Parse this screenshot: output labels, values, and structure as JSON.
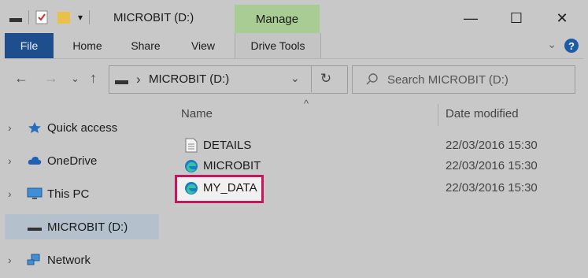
{
  "window": {
    "title": "MICROBIT (D:)",
    "context_tab": "Manage",
    "controls": {
      "minimize": "—",
      "maximize": "☐",
      "close": "✕"
    }
  },
  "ribbon": {
    "tabs": [
      "File",
      "Home",
      "Share",
      "View",
      "Drive Tools"
    ],
    "collapse_glyph": "⌄",
    "help_label": "?"
  },
  "navigation": {
    "back": "←",
    "forward": "→",
    "recent": "⌄",
    "up": "↑",
    "path": "MICROBIT (D:)",
    "separator": "›",
    "refresh": "↻",
    "search_placeholder": "Search MICROBIT (D:)"
  },
  "sidebar": {
    "items": [
      {
        "label": "Quick access",
        "icon": "star-icon",
        "expandable": true
      },
      {
        "label": "OneDrive",
        "icon": "cloud-icon",
        "expandable": true
      },
      {
        "label": "This PC",
        "icon": "monitor-icon",
        "expandable": true
      },
      {
        "label": "MICROBIT (D:)",
        "icon": "drive-icon",
        "expandable": false,
        "selected": true
      },
      {
        "label": "Network",
        "icon": "network-icon",
        "expandable": true
      }
    ]
  },
  "file_list": {
    "columns": {
      "name": "Name",
      "date_modified": "Date modified"
    },
    "sort_indicator": "^",
    "rows": [
      {
        "name": "DETAILS",
        "date_modified": "22/03/2016 15:30",
        "icon": "text-file-icon"
      },
      {
        "name": "MICROBIT",
        "date_modified": "22/03/2016 15:30",
        "icon": "edge-icon"
      },
      {
        "name": "MY_DATA",
        "date_modified": "22/03/2016 15:30",
        "icon": "edge-icon",
        "highlighted": true
      }
    ]
  },
  "colors": {
    "file_tab": "#1e4e8c",
    "manage_tab": "#a8cc93",
    "highlight_border": "#c2185b",
    "selected_item": "#b4c0cc"
  }
}
